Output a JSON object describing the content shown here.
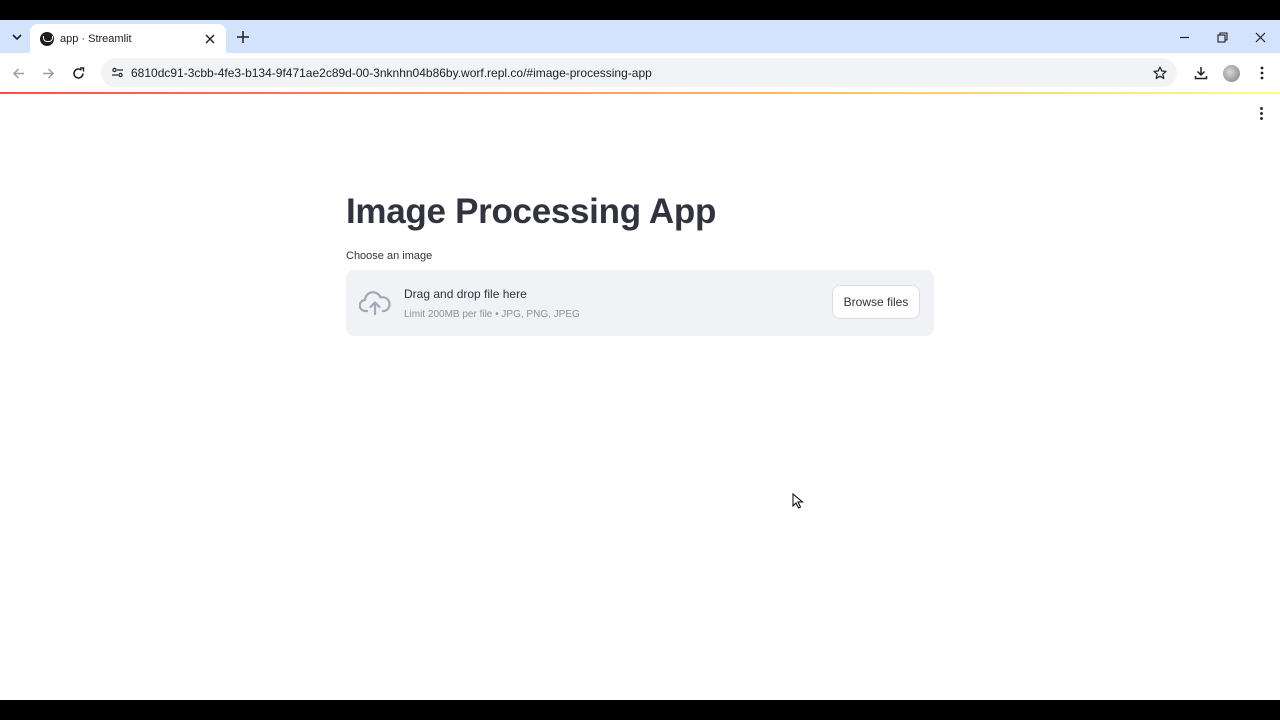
{
  "browser": {
    "tab_title": "app · Streamlit",
    "url": "6810dc91-3cbb-4fe3-b134-9f471ae2c89d-00-3nknhn04b86by.worf.repl.co/#image-processing-app"
  },
  "app": {
    "title": "Image Processing App",
    "uploader": {
      "label": "Choose an image",
      "drop_text": "Drag and drop file here",
      "limit_text": "Limit 200MB per file • JPG, PNG, JPEG",
      "browse_label": "Browse files"
    }
  },
  "icons": {
    "tab_search": "chevron-down-icon",
    "favicon": "streamlit-logo-icon",
    "close": "close-icon",
    "new_tab": "plus-icon",
    "back": "back-arrow-icon",
    "forward": "forward-arrow-icon",
    "reload": "reload-icon",
    "site_info": "site-settings-icon",
    "bookmark": "star-icon",
    "download": "download-icon",
    "profile": "avatar",
    "menu": "kebab-menu-icon",
    "upload": "cloud-upload-icon"
  },
  "colors": {
    "tabstrip": "#d3e3fd",
    "text": "#31333f",
    "dropzone": "#f0f2f6",
    "accent_start": "#ff4b4b",
    "accent_end": "#fffd80"
  }
}
